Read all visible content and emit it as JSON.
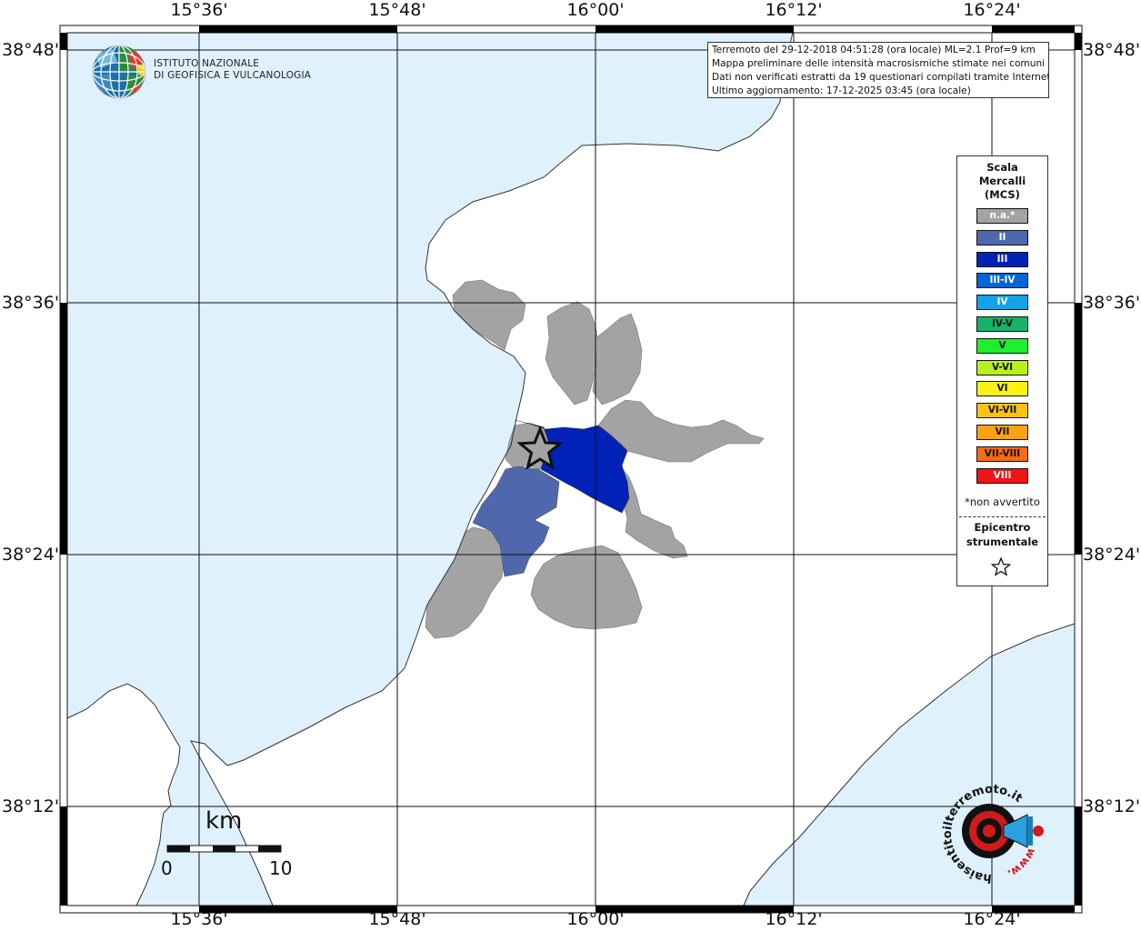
{
  "map": {
    "ticks_top": [
      {
        "label": "15°36'",
        "data_name": "lon-tick-top-15-36"
      },
      {
        "label": "15°48'",
        "data_name": "lon-tick-top-15-48"
      },
      {
        "label": "16°00'",
        "data_name": "lon-tick-top-16-00"
      },
      {
        "label": "16°12'",
        "data_name": "lon-tick-top-16-12"
      },
      {
        "label": "16°24'",
        "data_name": "lon-tick-top-16-24"
      }
    ],
    "ticks_left": [
      {
        "label": "38°48'",
        "data_name": "lat-tick-left-38-48"
      },
      {
        "label": "38°36'",
        "data_name": "lat-tick-left-38-36"
      },
      {
        "label": "38°24'",
        "data_name": "lat-tick-left-38-24"
      },
      {
        "label": "38°12'",
        "data_name": "lat-tick-left-38-12"
      }
    ],
    "colors": {
      "sea": "#dff1fc",
      "land": "#ffffff",
      "coast": "#333333",
      "grid": "#111111",
      "municipality_na": "#a3a3a3",
      "municipality_ii": "#4f68ad",
      "municipality_iii": "#0022b8"
    },
    "epicenter_icon": "star-icon"
  },
  "info": {
    "line1": "Terremoto del 29-12-2018 04:51:28 (ora locale) ML=2.1 Prof=9 km",
    "line2": "Mappa preliminare delle intensità macrosismiche stimate nei comuni",
    "line3": "Dati non verificati estratti da 19 questionari compilati tramite Internet.",
    "line4": "Ultimo aggiornamento: 17-12-2025 03:45 (ora locale)"
  },
  "institute": {
    "line1": "ISTITUTO NAZIONALE",
    "line2": "DI GEOFISICA E VULCANOLOGIA",
    "logo_icon": "globe-icon"
  },
  "legend": {
    "title1": "Scala",
    "title2": "Mercalli",
    "title3": "(MCS)",
    "items": [
      {
        "label": "n.a.*",
        "color": "#a3a3a3",
        "text_color": "#ffffff"
      },
      {
        "label": "II",
        "color": "#4f68ad",
        "text_color": "#ffffff"
      },
      {
        "label": "III",
        "color": "#0022b8",
        "text_color": "#ffffff"
      },
      {
        "label": "III-IV",
        "color": "#0066d1",
        "text_color": "#ffffff"
      },
      {
        "label": "IV",
        "color": "#13a2e8",
        "text_color": "#ffffff"
      },
      {
        "label": "IV-V",
        "color": "#13b46a",
        "text_color": "#111111"
      },
      {
        "label": "V",
        "color": "#1cf02e",
        "text_color": "#111111"
      },
      {
        "label": "V-VI",
        "color": "#b7f01e",
        "text_color": "#111111"
      },
      {
        "label": "VI",
        "color": "#fbf114",
        "text_color": "#111111"
      },
      {
        "label": "VI-VII",
        "color": "#fbc214",
        "text_color": "#111111"
      },
      {
        "label": "VII",
        "color": "#fba214",
        "text_color": "#111111"
      },
      {
        "label": "VII-VIII",
        "color": "#f86a14",
        "text_color": "#111111"
      },
      {
        "label": "VIII",
        "color": "#f01414",
        "text_color": "#ffffff"
      }
    ],
    "na_note": "*non avvertito",
    "epicenter1": "Epicentro",
    "epicenter2": "strumentale"
  },
  "scalebar": {
    "unit": "km",
    "zero": "0",
    "max": "10"
  },
  "hsi": {
    "site": "haisentitoilterremoto.it",
    "www": "www.",
    "logo_icon": "target-megaphone-icon"
  }
}
